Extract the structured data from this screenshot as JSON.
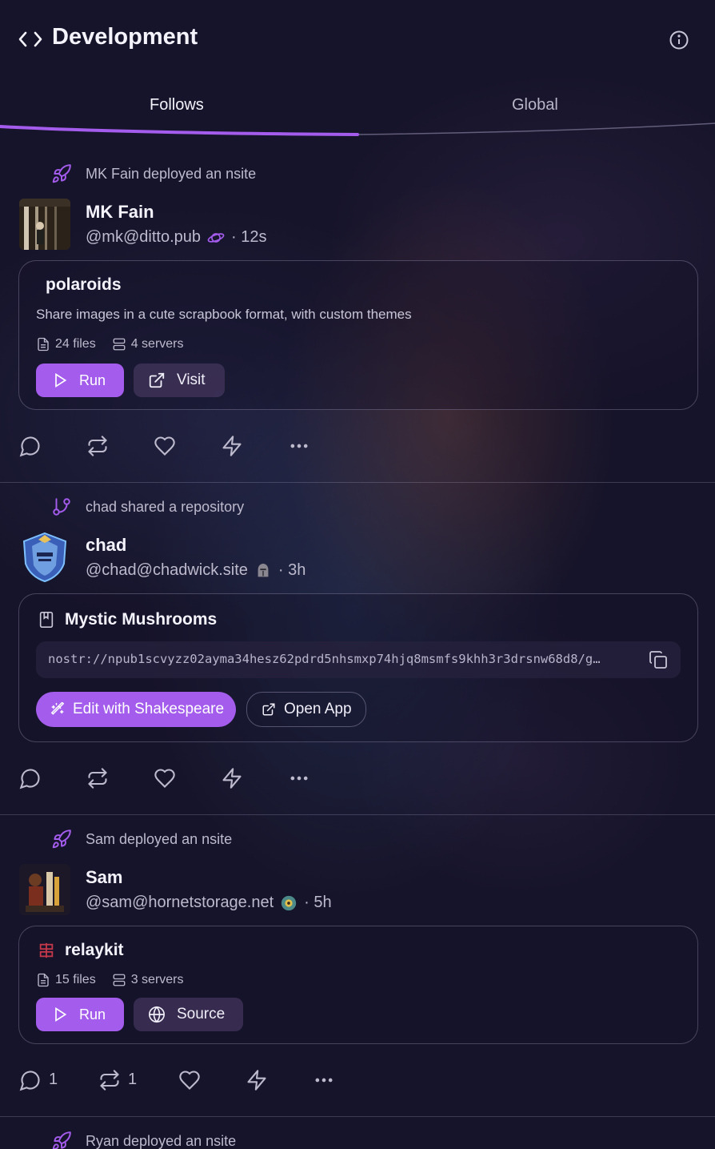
{
  "header": {
    "title": "Development",
    "icon": "code-icon",
    "info_icon": "info-icon"
  },
  "tabs": [
    {
      "label": "Follows",
      "active": true
    },
    {
      "label": "Global",
      "active": false
    }
  ],
  "accent": "#a45cec",
  "posts": [
    {
      "activity": "MK Fain deployed an nsite",
      "activity_icon": "rocket-icon",
      "name": "MK Fain",
      "handle": "@mk@ditto.pub",
      "badge_icon": "planet-icon",
      "time": "· 12s",
      "card": {
        "type": "nsite",
        "title": "polaroids",
        "description": "Share images in a cute scrapbook format, with custom themes",
        "files": "24 files",
        "servers": "4 servers",
        "primary_label": "Run",
        "secondary_label": "Visit"
      },
      "counts": {
        "replies": "",
        "reposts": ""
      }
    },
    {
      "activity": "chad shared a repository",
      "activity_icon": "git-branch-icon",
      "name": "chad",
      "handle": "@chad@chadwick.site",
      "badge_icon": "knight-helmet-icon",
      "time": "· 3h",
      "card": {
        "type": "repository",
        "title": "Mystic Mushrooms",
        "url": "nostr://npub1scvyzz02ayma34hesz62pdrd5nhsmxp74hjq8msmfs9khh3r3drsnw68d8/g…",
        "primary_label": "Edit with Shakespeare",
        "secondary_label": "Open App"
      },
      "counts": {
        "replies": "",
        "reposts": ""
      }
    },
    {
      "activity": "Sam deployed an nsite",
      "activity_icon": "rocket-icon",
      "name": "Sam",
      "handle": "@sam@hornetstorage.net",
      "badge_icon": "hornet-badge-icon",
      "time": "· 5h",
      "card": {
        "type": "nsite",
        "title": "relaykit",
        "files": "15 files",
        "servers": "3 servers",
        "primary_label": "Run",
        "secondary_label": "Source"
      },
      "counts": {
        "replies": "1",
        "reposts": "1"
      }
    },
    {
      "activity": "Ryan deployed an nsite",
      "activity_icon": "rocket-icon"
    }
  ]
}
